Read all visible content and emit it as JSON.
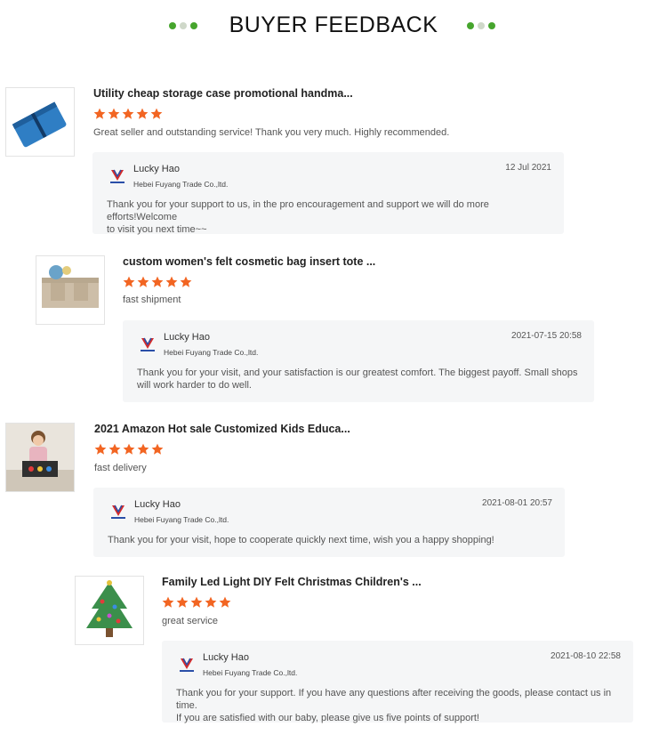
{
  "header": {
    "title": "BUYER FEEDBACK",
    "dot_colors": [
      "#46a52d",
      "#cfd8c9",
      "#46a52d"
    ]
  },
  "colors": {
    "star": "#f26522",
    "reply_bg": "#f5f6f7",
    "logo_red": "#d42b2b",
    "logo_blue": "#2a4fa8"
  },
  "seller": {
    "name": "Lucky Hao",
    "company": "Hebei Fuyang Trade Co.,ltd."
  },
  "reviews": [
    {
      "product_title": "Utility cheap storage case promotional handma...",
      "rating": 5,
      "comment": "Great seller and outstanding service! Thank you very much. Highly recommended.",
      "image": "blue-storage-case",
      "reply_date": "12 Jul 2021",
      "reply_lines": [
        "Thank you for your support to us, in the pro encouragement and support we will do more efforts!Welcome",
        "to visit you next time~~"
      ]
    },
    {
      "product_title": "custom women's felt cosmetic bag insert tote ...",
      "rating": 5,
      "comment": "fast shipment",
      "image": "felt-organizer-insert",
      "reply_date": "2021-07-15 20:58",
      "reply_lines": [
        "Thank you for your visit, and your satisfaction is our greatest comfort.  The biggest payoff.  Small shops",
        "will work harder to do well."
      ]
    },
    {
      "product_title": "2021 Amazon Hot sale Customized Kids Educa...",
      "rating": 5,
      "comment": "fast delivery",
      "image": "kid-with-busy-board",
      "reply_date": "2021-08-01 20:57",
      "reply_lines": [
        "Thank you for your visit, hope to cooperate quickly next time, wish you a happy shopping!"
      ]
    },
    {
      "product_title": "Family Led Light DIY Felt Christmas Children's ...",
      "rating": 5,
      "comment": "great service",
      "image": "felt-christmas-tree",
      "reply_date": "2021-08-10 22:58",
      "reply_lines": [
        "Thank you for your support. If you have any questions after receiving the goods, please contact us in time.",
        "If you are satisfied with our baby, please give us five points of support!"
      ]
    }
  ]
}
